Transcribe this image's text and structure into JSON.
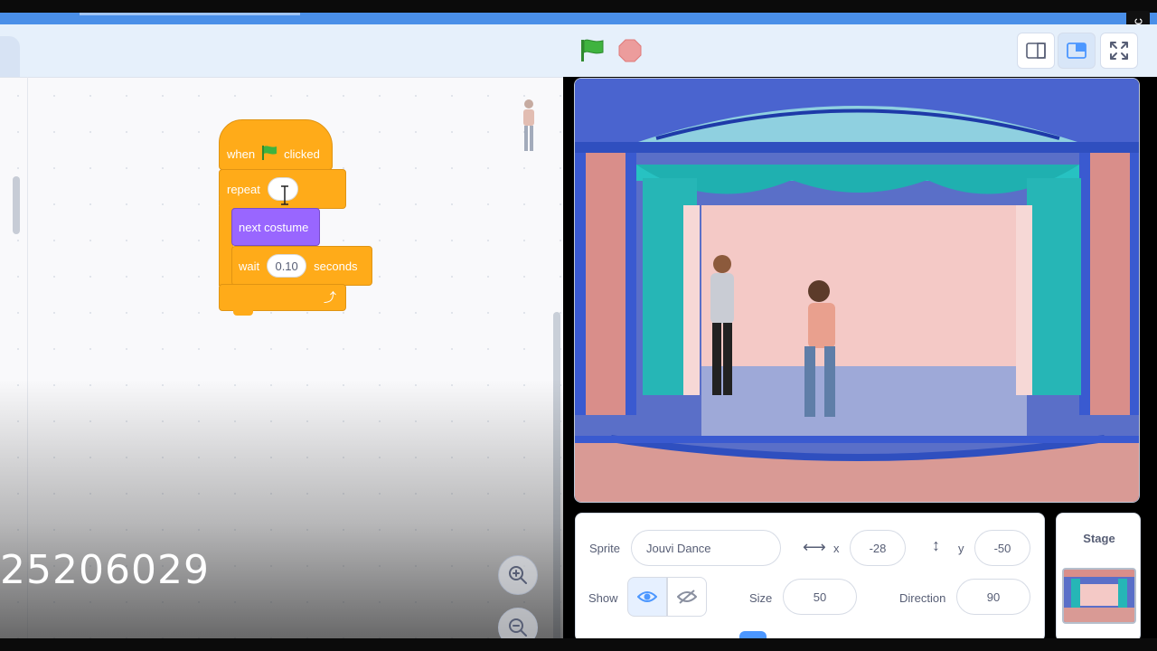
{
  "recording_badge": "rec",
  "code": {
    "hat_when": "when",
    "hat_clicked": "clicked",
    "repeat_label": "repeat",
    "repeat_value": "",
    "next_costume": "next costume",
    "wait_label": "wait",
    "wait_value": "0.10",
    "wait_seconds": "seconds",
    "loop_arrow": "⤴"
  },
  "overlay_number": "25206029",
  "sprite_info": {
    "sprite_label": "Sprite",
    "sprite_name": "Jouvi Dance",
    "x_label": "x",
    "x_value": "-28",
    "y_label": "y",
    "y_value": "-50",
    "show_label": "Show",
    "size_label": "Size",
    "size_value": "50",
    "direction_label": "Direction",
    "direction_value": "90"
  },
  "stage_panel": {
    "label": "Stage"
  },
  "colors": {
    "events_block": "#ffab19",
    "looks_block": "#9966ff",
    "green_flag": "#3fb33f",
    "stop": "#ec9c9c",
    "accent": "#4c97ff"
  }
}
